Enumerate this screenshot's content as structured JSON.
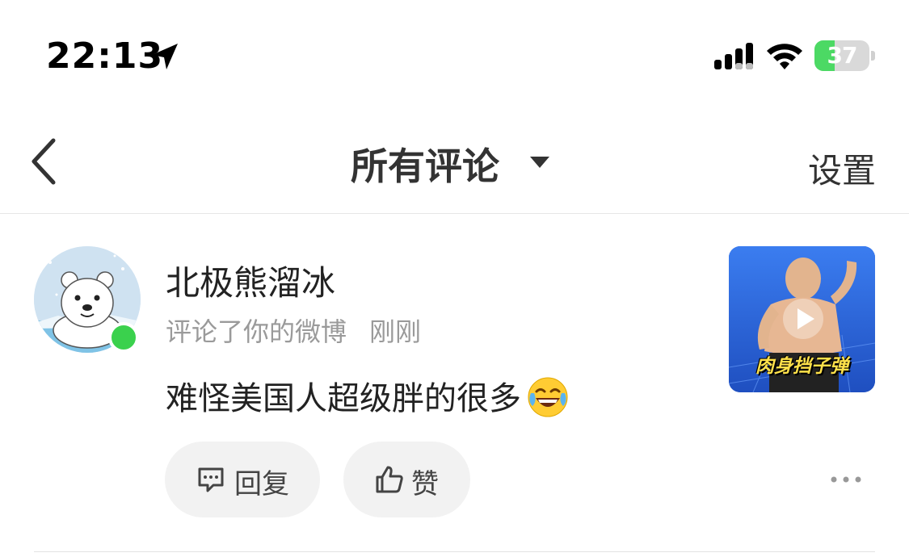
{
  "status_bar": {
    "time": "22:13",
    "battery_level": "37",
    "battery_fraction": 0.37,
    "icons": [
      "location-arrow-icon",
      "cellular-signal-icon",
      "wifi-icon",
      "battery-charging-icon"
    ]
  },
  "nav": {
    "title": "所有评论",
    "settings_label": "设置",
    "icons": [
      "back-chevron-icon",
      "dropdown-caret-icon"
    ]
  },
  "comment": {
    "username": "北极熊溜冰",
    "action": "评论了你的微博",
    "time_ago": "刚刚",
    "text": "难怪美国人超级胖的很多",
    "emoji": "laughing-tears-emoji",
    "thumbnail_caption": "肉身挡子弹",
    "reply_label": "回复",
    "like_label": "赞",
    "online": true
  },
  "colors": {
    "online_dot": "#3ad14d",
    "battery_green": "#4cd964",
    "button_bg": "#f2f2f2",
    "meta_gray": "#9a9a9a"
  }
}
